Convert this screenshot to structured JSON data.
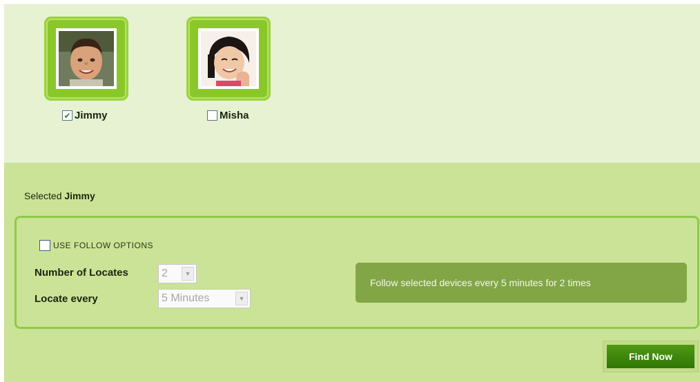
{
  "devices": [
    {
      "name": "Jimmy",
      "checked": true
    },
    {
      "name": "Misha",
      "checked": false
    }
  ],
  "selection": {
    "prefix": "Selected",
    "name": "Jimmy"
  },
  "follow_options": {
    "label": "USE FOLLOW OPTIONS",
    "checked": false,
    "number_of_locates_label": "Number of Locates",
    "number_of_locates_value": "2",
    "locate_every_label": "Locate every",
    "locate_every_value": "5 Minutes",
    "summary": "Follow selected devices every 5 minutes for 2 times"
  },
  "actions": {
    "find_now": "Find Now"
  },
  "colors": {
    "top_panel": "#e6f2d2",
    "bottom_panel": "#cbe396",
    "frame_green": "#8ac82a",
    "summary_bg": "#82a646",
    "button_green": "#3f8a0c"
  }
}
